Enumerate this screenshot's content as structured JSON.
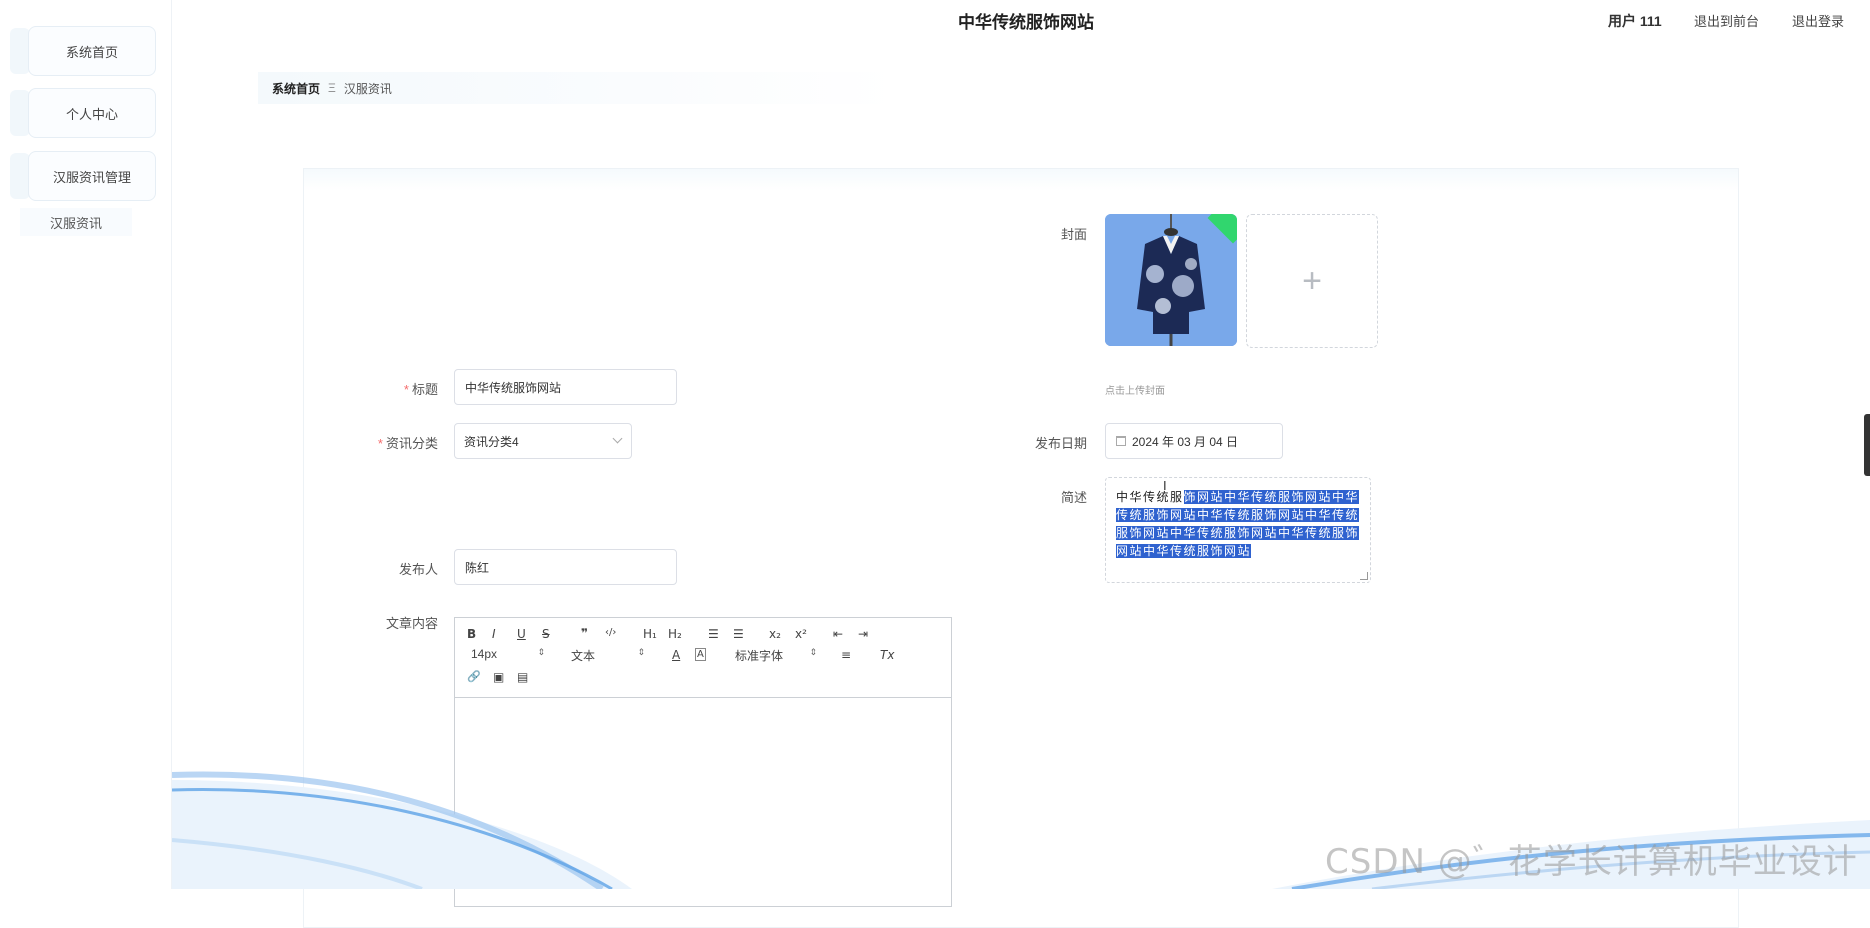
{
  "header": {
    "title": "中华传统服饰网站",
    "user": "用户 111",
    "back_to_front": "退出到前台",
    "logout": "退出登录"
  },
  "sidebar": {
    "items": [
      {
        "label": "系统首页"
      },
      {
        "label": "个人中心"
      },
      {
        "label": "汉服资讯管理"
      }
    ],
    "sub_item": "汉服资讯"
  },
  "breadcrumb": {
    "home": "系统首页",
    "separator": "Ξ",
    "current": "汉服资讯"
  },
  "form": {
    "cover_label": "封面",
    "upload_tip": "点击上传封面",
    "upload_plus": "+",
    "title_label": "标题",
    "title_value": "中华传统服饰网站",
    "category_label": "资讯分类",
    "category_value": "资讯分类4",
    "date_label": "发布日期",
    "date_value": "2024 年 03 月 04 日",
    "summary_label": "简述",
    "summary_plain": "中华传统服",
    "summary_selected": "饰网站中华传统服饰网站中华传统服饰网站中华传统服饰网站中华传统服饰网站中华传统服饰网站中华传统服饰网站中华传统服饰网站",
    "publisher_label": "发布人",
    "publisher_value": "陈红",
    "content_label": "文章内容",
    "required_mark": "*"
  },
  "editor": {
    "font_size": "14px",
    "block_format": "文本",
    "font_family": "标准字体",
    "buttons": {
      "bold": "B",
      "italic": "I",
      "underline": "U",
      "strike": "S",
      "quote": "❞",
      "code": "‹/›",
      "h1": "H₁",
      "h2": "H₂",
      "ordered_list": "☰",
      "bullet_list": "☰",
      "subscript": "x₂",
      "superscript": "x²",
      "outdent": "⇤",
      "indent": "⇥",
      "color": "A",
      "background": "A",
      "align": "≡",
      "clean": "Tx",
      "link": "🔗",
      "image": "▣",
      "video": "▤"
    }
  },
  "watermark": "CSDN @゛花学长计算机毕业设计",
  "colors": {
    "selection": "#2f62cf",
    "required": "#f56c6c",
    "cover_badge": "#31d66e"
  }
}
